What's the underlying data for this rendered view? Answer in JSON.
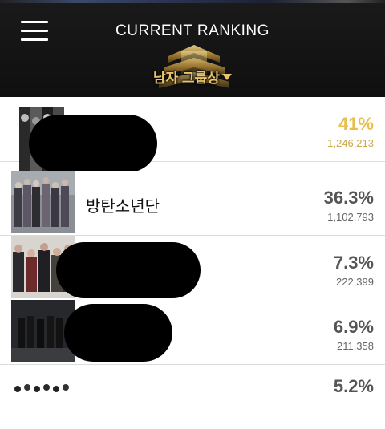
{
  "header": {
    "title": "CURRENT RANKING",
    "category": "남자 그룹상"
  },
  "colors": {
    "header_bg": "#141414",
    "accent_gold": "#e8bf4a",
    "text_gray": "#555555"
  },
  "icons": {
    "menu": "hamburger-menu-icon",
    "dropdown": "chevron-down-icon"
  },
  "rankings": [
    {
      "name": "",
      "percent": "41%",
      "votes": "1,246,213",
      "name_redacted": true
    },
    {
      "name": "방탄소년단",
      "percent": "36.3%",
      "votes": "1,102,793",
      "name_redacted": false
    },
    {
      "name": "",
      "percent": "7.3%",
      "votes": "222,399",
      "name_redacted": true
    },
    {
      "name": "",
      "percent": "6.9%",
      "votes": "211,358",
      "name_redacted": true
    },
    {
      "name": "",
      "percent": "5.2%",
      "votes": "",
      "name_redacted": false
    }
  ]
}
